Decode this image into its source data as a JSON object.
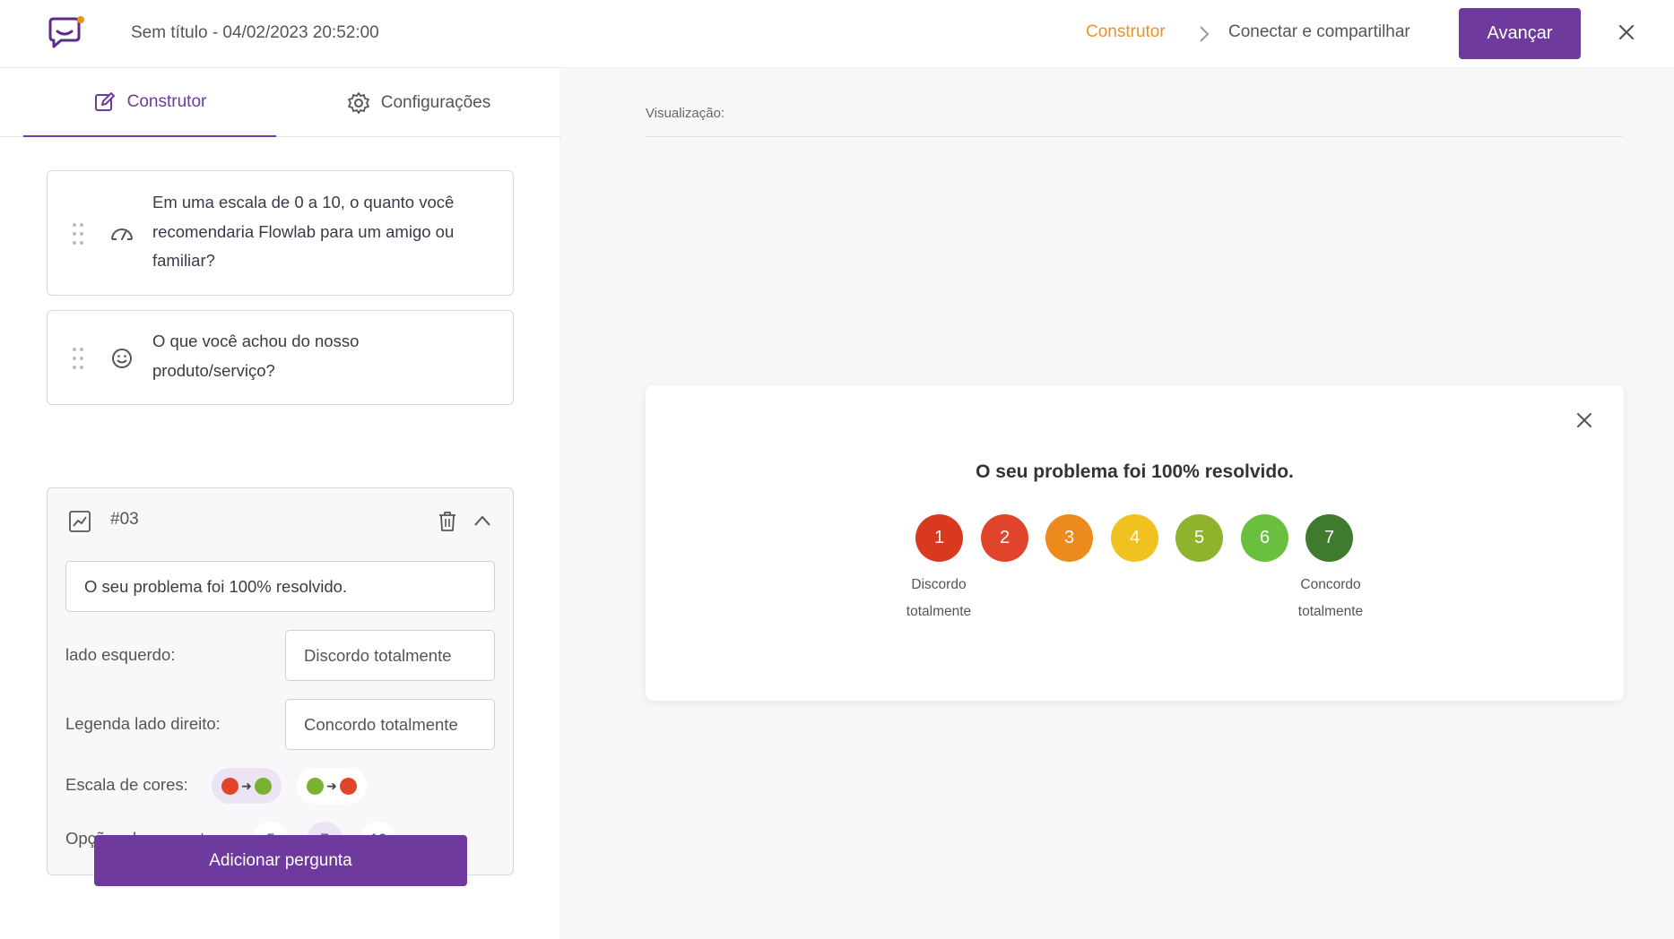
{
  "header": {
    "doc_title": "Sem título - 04/02/2023 20:52:00",
    "breadcrumb": [
      "Construtor",
      "Conectar e compartilhar"
    ],
    "advance_label": "Avançar"
  },
  "tabs": [
    {
      "label": "Construtor",
      "icon": "edit-icon",
      "active": true
    },
    {
      "label": "Configurações",
      "icon": "gear-icon",
      "active": false
    }
  ],
  "questions": [
    {
      "icon": "gauge-icon",
      "text": "Em uma escala de 0 a 10, o quanto você recomendaria Flowlab para um amigo ou familiar?"
    },
    {
      "icon": "smile-icon",
      "text": "O que você achou do nosso produto/serviço?"
    }
  ],
  "active_question": {
    "number": "#03",
    "icon": "chart-line-icon",
    "question_value": "O seu problema foi 100% resolvido.",
    "left_label": "lado esquerdo:",
    "left_value": "Discordo totalmente",
    "right_label": "Legenda lado direito:",
    "right_value": "Concordo totalmente",
    "color_scale_label": "Escala de cores:",
    "color_scales": [
      {
        "from": "#e0452b",
        "to": "#79b233",
        "selected": true
      },
      {
        "from": "#79b233",
        "to": "#e0452b",
        "selected": false
      }
    ],
    "options_label": "Opções de respostas:",
    "options": [
      "5",
      "7",
      "10"
    ],
    "selected_option": "7"
  },
  "add_question_label": "Adicionar pergunta",
  "preview": {
    "label": "Visualização:",
    "title": "O seu problema foi 100% resolvido.",
    "scale": [
      {
        "value": "1",
        "color": "#d9391f"
      },
      {
        "value": "2",
        "color": "#e0452b"
      },
      {
        "value": "3",
        "color": "#ec8a1d"
      },
      {
        "value": "4",
        "color": "#f0c21f"
      },
      {
        "value": "5",
        "color": "#8fb32c"
      },
      {
        "value": "6",
        "color": "#6abf3f"
      },
      {
        "value": "7",
        "color": "#3f7a2e"
      }
    ],
    "left_legend": [
      "Discordo",
      "totalmente"
    ],
    "right_legend": [
      "Concordo",
      "totalmente"
    ]
  },
  "colors": {
    "accent": "#6e3a9e",
    "breadcrumb_active": "#f0911e"
  }
}
